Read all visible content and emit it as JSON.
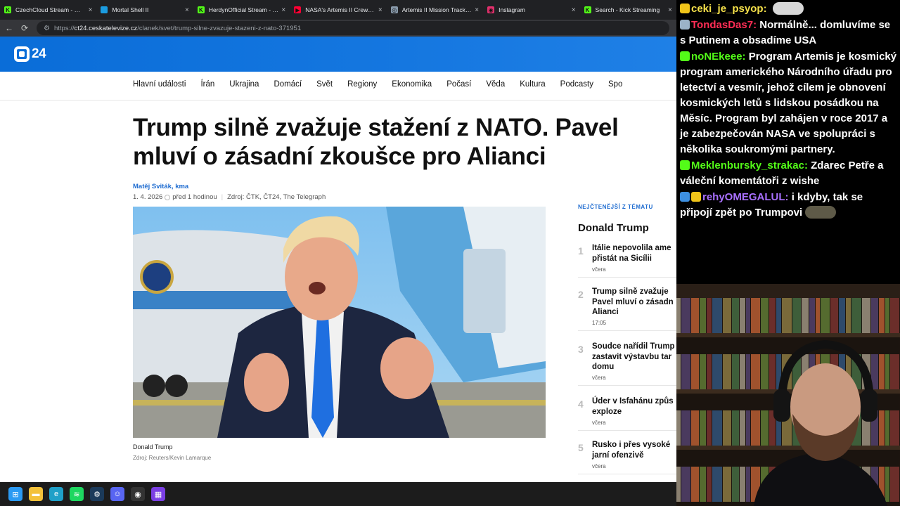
{
  "browser": {
    "tabs": [
      {
        "label": "CzechCloud Stream - Watch Liv",
        "icon": "kick-icon",
        "color": "#53fc18",
        "glyph": "K"
      },
      {
        "label": "Mortal Shell II",
        "icon": "steam-icon",
        "color": "#1b9ce0",
        "glyph": ""
      },
      {
        "label": "HerdynOfficial Stream - Watch",
        "icon": "kick-icon",
        "color": "#53fc18",
        "glyph": "K"
      },
      {
        "label": "NASA's Artemis II Crew Launch",
        "icon": "youtube-icon",
        "color": "#ff0033",
        "glyph": "▶"
      },
      {
        "label": "Artemis II Mission Tracker | Liv",
        "icon": "compass-icon",
        "color": "#8899aa",
        "glyph": "◎"
      },
      {
        "label": "Instagram",
        "icon": "instagram-icon",
        "color": "#e1306c",
        "glyph": "◉"
      },
      {
        "label": "Search - Kick Streaming",
        "icon": "kick-icon",
        "color": "#53fc18",
        "glyph": "K"
      }
    ],
    "url_prefix": "https://",
    "url_host": "ct24.ceskatelevize.cz",
    "url_path": "/clanek/svet/trump-silne-zvazuje-stazeni-z-nato-371951"
  },
  "site": {
    "logo_text": "24",
    "nav": [
      "Hlavní události",
      "Írán",
      "Ukrajina",
      "Domácí",
      "Svět",
      "Regiony",
      "Ekonomika",
      "Počasí",
      "Věda",
      "Kultura",
      "Podcasty",
      "Spo"
    ],
    "headline": "Trump silně zvažuje stažení z NATO. Pavel mluví o zásadní zkoušce pro Alianci",
    "author": "Matěj Sviták, kma",
    "date": "1. 4. 2026",
    "ago": "před 1 hodinou",
    "source": "Zdroj: ČTK, ČT24, The Telegraph",
    "photo_caption": "Donald Trump",
    "photo_credit": "Zdroj: Reuters/Kevin Lamarque",
    "sidebar": {
      "kicker": "NEJČTENĚJŠÍ Z TÉMATU",
      "title": "Donald Trump",
      "items": [
        {
          "num": "1",
          "title": "Itálie nepovolila ame přistát na Sicílii",
          "time": "včera"
        },
        {
          "num": "2",
          "title": "Trump silně zvažuje Pavel mluví o zásadn Alianci",
          "time": "17:05"
        },
        {
          "num": "3",
          "title": "Soudce nařídil Trump zastavit výstavbu tar domu",
          "time": "včera"
        },
        {
          "num": "4",
          "title": "Úder v Isfahánu způs exploze",
          "time": "včera"
        },
        {
          "num": "5",
          "title": "Rusko i přes vysoké jarní ofenzivě",
          "time": "včera"
        }
      ]
    }
  },
  "taskbar": {
    "icons": [
      "windows-start-icon",
      "file-explorer-icon",
      "edge-icon",
      "spotify-icon",
      "steam-icon",
      "discord-icon",
      "obs-icon",
      "app-grid-icon"
    ]
  },
  "chat": {
    "messages": [
      {
        "user": "ceki_je_psyop",
        "user_color": "#f5e04a",
        "text": "",
        "badges": [
          "#f0c419"
        ],
        "emote": true,
        "emote_color": "#d8d8d8"
      },
      {
        "user": "TondasDas7",
        "user_color": "#ff2d55",
        "text": "Normálně... domluvíme se s Putinem a obsadíme USA",
        "badges": [
          "#9bb3c8"
        ],
        "emote": false
      },
      {
        "user": "noNEkeee",
        "user_color": "#53fc18",
        "text": "Program Artemis je kosmický program amerického Národního úřadu pro letectví a vesmír, jehož cílem je obnovení kosmických letů s lidskou posádkou na Měsíc. Program byl zahájen v roce 2017 a je zabezpečován NASA ve spolupráci s několika soukromými partnery.",
        "badges": [
          "#53fc18"
        ],
        "emote": false
      },
      {
        "user": "Meklenbursky_strakac",
        "user_color": "#53fc18",
        "text": "Zdarec Petře a váleční komentátoři z wishe",
        "badges": [
          "#53fc18"
        ],
        "emote": false
      },
      {
        "user": "rehyOMEGALUL",
        "user_color": "#a970ff",
        "text": "i kdyby, tak se připojí zpět po Trumpovi",
        "badges": [
          "#3d8fe0",
          "#f0c419"
        ],
        "emote": true,
        "emote_color": "#5e5a48"
      }
    ]
  }
}
